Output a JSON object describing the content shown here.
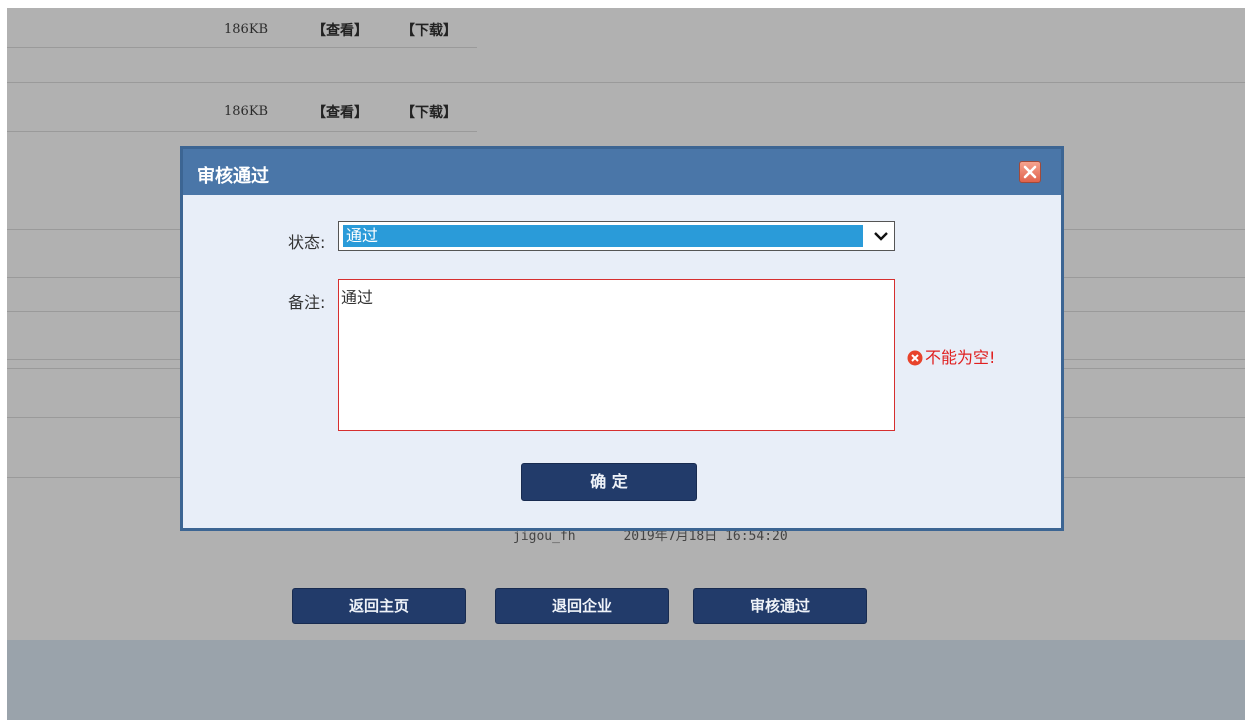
{
  "attachments": [
    {
      "size": "186KB",
      "view_label": "【查看】",
      "download_label": "【下载】"
    },
    {
      "size": "186KB",
      "view_label": "【查看】",
      "download_label": "【下载】"
    }
  ],
  "record_meta": {
    "user": "jigou_fh",
    "datetime": "2019年7月18日 16:54:20"
  },
  "page_buttons": {
    "home": "返回主页",
    "return": "退回企业",
    "approve": "审核通过"
  },
  "dialog": {
    "title": "审核通过",
    "status_label": "状态:",
    "status_value": "通过",
    "remark_label": "备注:",
    "remark_value": "通过",
    "error_text": "不能为空!",
    "confirm_label": "确 定"
  },
  "colors": {
    "dialog_header": "#4a76a8",
    "button_bg": "#223b6a",
    "select_highlight": "#2a9bd9",
    "error": "#e02020"
  },
  "icons": [
    "close-icon",
    "chevron-down-icon",
    "error-icon"
  ]
}
